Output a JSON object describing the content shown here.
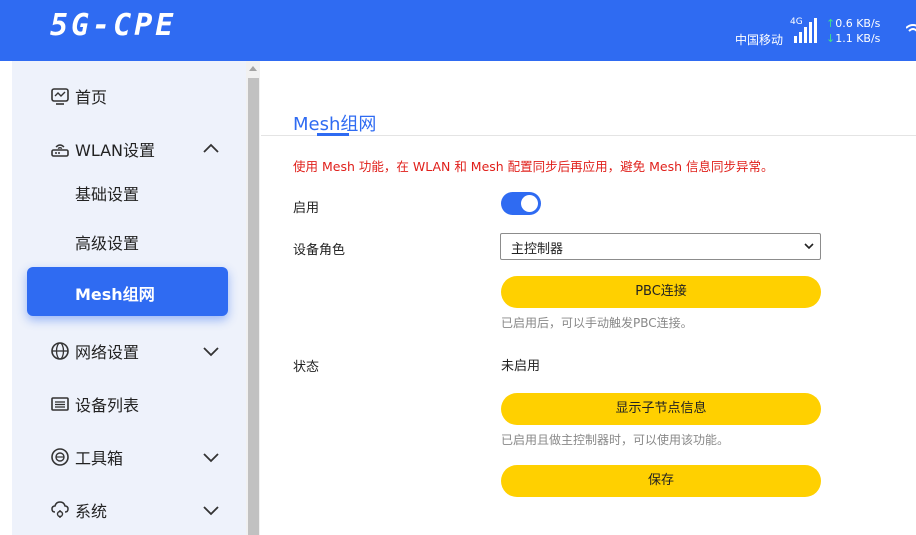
{
  "header": {
    "logo": "5G-CPE",
    "carrier": "中国移动",
    "network_type": "4G",
    "upload_rate": "0.6 KB/s",
    "download_rate": "1.1 KB/s",
    "brand_color": "#2f6bf2"
  },
  "sidebar": {
    "items": [
      {
        "label": "首页",
        "icon": "monitor-icon"
      },
      {
        "label": "WLAN设置",
        "icon": "router-icon",
        "expanded": true
      },
      {
        "label": "基础设置"
      },
      {
        "label": "高级设置"
      },
      {
        "label": "Mesh组网",
        "active": true
      },
      {
        "label": "网络设置",
        "icon": "globe-icon"
      },
      {
        "label": "设备列表",
        "icon": "list-icon"
      },
      {
        "label": "工具箱",
        "icon": "toolbox-icon"
      },
      {
        "label": "系统",
        "icon": "cloud-gear-icon"
      }
    ]
  },
  "main": {
    "tab_title": "Mesh组网",
    "warning": "使用 Mesh 功能，在 WLAN 和 Mesh 配置同步后再应用，避免 Mesh 信息同步异常。",
    "enable_label": "启用",
    "enable_on": true,
    "role_label": "设备角色",
    "role_value": "主控制器",
    "pbc_button": "PBC连接",
    "pbc_hint": "已启用后，可以手动触发PBC连接。",
    "status_label": "状态",
    "status_value": "未启用",
    "show_nodes_button": "显示子节点信息",
    "show_nodes_hint": "已启用且做主控制器时，可以使用该功能。",
    "save_button": "保存",
    "button_color": "#ffd000",
    "warning_color": "#e0201b"
  }
}
